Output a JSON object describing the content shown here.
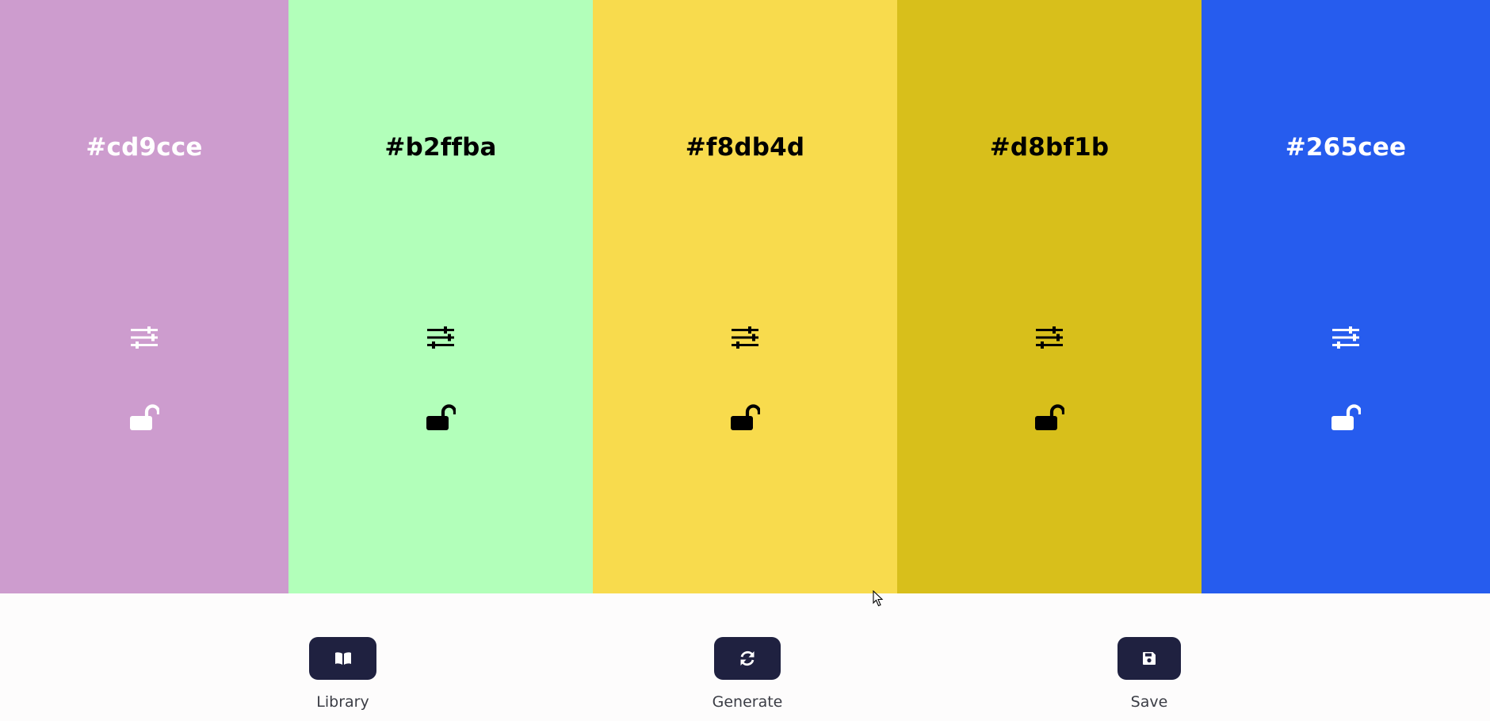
{
  "palette": {
    "swatches": [
      {
        "hex_label": "#cd9cce",
        "color": "#cd9cce",
        "text_color": "#ffffff",
        "adjust_icon": "sliders-icon",
        "lock_icon": "unlock-icon"
      },
      {
        "hex_label": "#b2ffba",
        "color": "#b2ffba",
        "text_color": "#000000",
        "adjust_icon": "sliders-icon",
        "lock_icon": "unlock-icon"
      },
      {
        "hex_label": "#f8db4d",
        "color": "#f8db4d",
        "text_color": "#000000",
        "adjust_icon": "sliders-icon",
        "lock_icon": "unlock-icon"
      },
      {
        "hex_label": "#d8bf1b",
        "color": "#d8bf1b",
        "text_color": "#000000",
        "adjust_icon": "sliders-icon",
        "lock_icon": "unlock-icon"
      },
      {
        "hex_label": "#265cee",
        "color": "#265cee",
        "text_color": "#ffffff",
        "adjust_icon": "sliders-icon",
        "lock_icon": "unlock-icon"
      }
    ]
  },
  "toolbar": {
    "library": {
      "label": "Library",
      "icon": "book-icon"
    },
    "generate": {
      "label": "Generate",
      "icon": "refresh-icon"
    },
    "save": {
      "label": "Save",
      "icon": "floppy-disk-icon"
    },
    "button_color": "#1f2140"
  }
}
